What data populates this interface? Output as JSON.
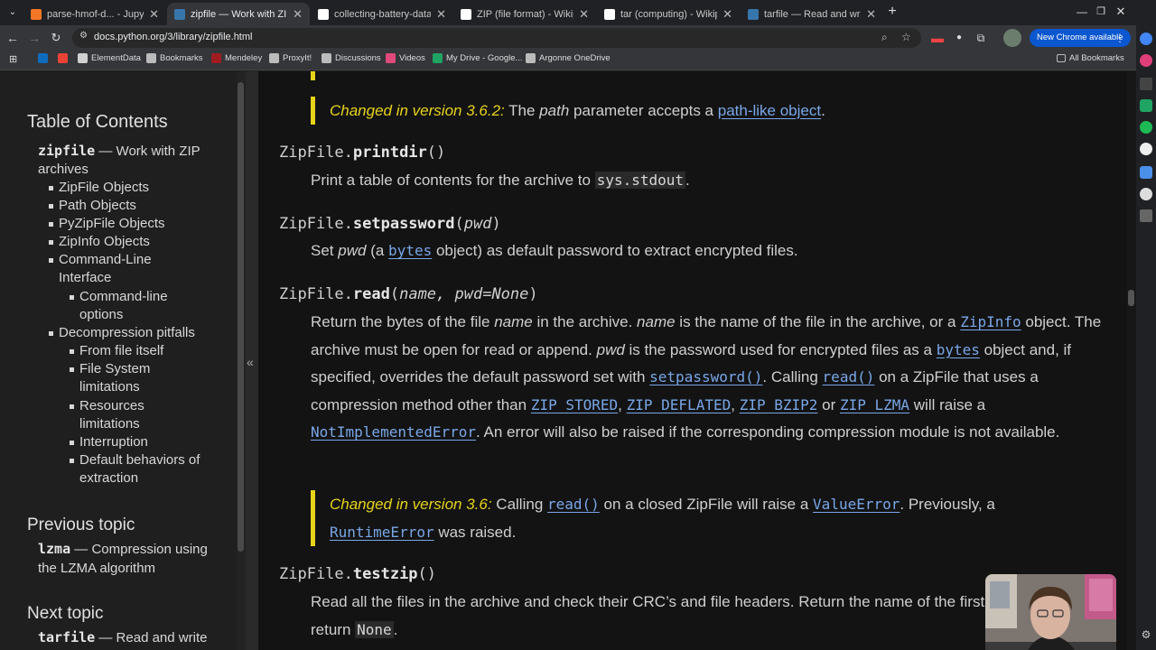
{
  "tabs": [
    {
      "title": "parse-hmof-d... - JupyterLab",
      "icon": "jupyter-icon",
      "color": "#f37726"
    },
    {
      "title": "zipfile — Work with ZIP archives",
      "icon": "python-icon",
      "color": "#3776ab",
      "active": true
    },
    {
      "title": "collecting-battery-datasets",
      "icon": "github-icon",
      "color": "#ffffff"
    },
    {
      "title": "ZIP (file format) - Wikipedia",
      "icon": "wikipedia-icon",
      "color": "#ffffff"
    },
    {
      "title": "tar (computing) - Wikipedia",
      "icon": "wikipedia-icon",
      "color": "#ffffff"
    },
    {
      "title": "tarfile — Read and write tar archive files",
      "icon": "python-icon",
      "color": "#3776ab"
    }
  ],
  "browser": {
    "url": "docs.python.org/3/library/zipfile.html",
    "new_chrome": "New Chrome available",
    "all_bookmarks": "All Bookmarks"
  },
  "bookmarks": [
    {
      "label": "",
      "icon": "outlook-icon",
      "color": "#0f6cbd"
    },
    {
      "label": "",
      "icon": "gmail-icon",
      "color": "#ea4335"
    },
    {
      "label": "ElementData",
      "icon": "elementdata-icon",
      "color": "#d0d0d0"
    },
    {
      "label": "Bookmarks",
      "icon": "star-icon",
      "color": "#bbbbbb"
    },
    {
      "label": "Mendeley",
      "icon": "mendeley-icon",
      "color": "#9f1d20"
    },
    {
      "label": "ProxyIt!",
      "icon": "proxy-icon",
      "color": "#bbbbbb"
    },
    {
      "label": "Discussions",
      "icon": "discussion-icon",
      "color": "#bbbbbb"
    },
    {
      "label": "Videos",
      "icon": "video-icon",
      "color": "#e04a7a"
    },
    {
      "label": "My Drive - Google...",
      "icon": "drive-icon",
      "color": "#1fa463"
    },
    {
      "label": "Argonne OneDrive",
      "icon": "onedrive-icon",
      "color": "#bbbbbb"
    }
  ],
  "sidebar": {
    "toc_title": "Table of Contents",
    "module_code": "zipfile",
    "module_text": "— Work with ZIP archives",
    "items": [
      "ZipFile Objects",
      "Path Objects",
      "PyZipFile Objects",
      "ZipInfo Objects",
      "Command-Line Interface",
      "Command-line options",
      "Decompression pitfalls",
      "From file itself",
      "File System limitations",
      "Resources limitations",
      "Interruption",
      "Default behaviors of extraction"
    ],
    "prev_title": "Previous topic",
    "prev_code": "lzma",
    "prev_text": "— Compression using the LZMA algorithm",
    "next_title": "Next topic",
    "next_code": "tarfile",
    "next_text": "— Read and write"
  },
  "main": {
    "change1_label": "Changed in version 3.6.2:",
    "change1_pre": "The",
    "change1_param": "path",
    "change1_mid": "parameter accepts a",
    "change1_link": "path-like object",
    "change1_post": ".",
    "printdir_cls": "ZipFile.",
    "printdir_name": "printdir",
    "printdir_args": "()",
    "printdir_desc": "Print a table of contents for the archive to",
    "printdir_code": "sys.stdout",
    "printdir_post": ".",
    "setpw_cls": "ZipFile.",
    "setpw_name": "setpassword",
    "setpw_open": "(",
    "setpw_arg": "pwd",
    "setpw_close": ")",
    "setpw_1": "Set",
    "setpw_2": "pwd",
    "setpw_3": "(a",
    "setpw_link": "bytes",
    "setpw_4": "object) as default password to extract encrypted files.",
    "read_cls": "ZipFile.",
    "read_name": "read",
    "read_open": "(",
    "read_args": "name, pwd=None",
    "read_close": ")",
    "read_1": "Return the bytes of the file",
    "read_2": "name",
    "read_3": "in the archive.",
    "read_4": "name",
    "read_5": "is the name of the file in the archive, or a",
    "read_zipinfo": "ZipInfo",
    "read_6": "object. The archive must be open for read or append.",
    "read_7": "pwd",
    "read_8": "is the password used for encrypted files as a",
    "read_bytes": "bytes",
    "read_9": "object and, if specified, overrides the default password set with",
    "read_setpw": "setpassword()",
    "read_10": ". Calling",
    "read_read": "read()",
    "read_11": "on a ZipFile that uses a compression method other than",
    "read_stored": "ZIP_STORED",
    "read_comma1": ",",
    "read_deflated": "ZIP_DEFLATED",
    "read_comma2": ",",
    "read_bzip2": "ZIP_BZIP2",
    "read_or": "or",
    "read_lzma": "ZIP_LZMA",
    "read_12": "will raise a",
    "read_notimpl": "NotImplementedError",
    "read_13": ". An error will also be raised if the corresponding compression module is not available.",
    "change2_label": "Changed in version 3.6:",
    "change2_1": "Calling",
    "change2_read": "read()",
    "change2_2": "on a closed ZipFile will raise a",
    "change2_valerr": "ValueError",
    "change2_3": ". Previously, a",
    "change2_rterr": "RuntimeError",
    "change2_4": "was raised.",
    "testzip_cls": "ZipFile.",
    "testzip_name": "testzip",
    "testzip_args": "()",
    "testzip_1": "Read all the files in the archive and check their CRC’s and file headers. Return the name of the first bad file, or else return",
    "testzip_none": "None",
    "testzip_2": "."
  },
  "colors": {
    "link": "#79a7e8",
    "version_accent": "#e8d31a",
    "page_bg": "#131313",
    "sidebar_bg": "#1f1f1f"
  }
}
